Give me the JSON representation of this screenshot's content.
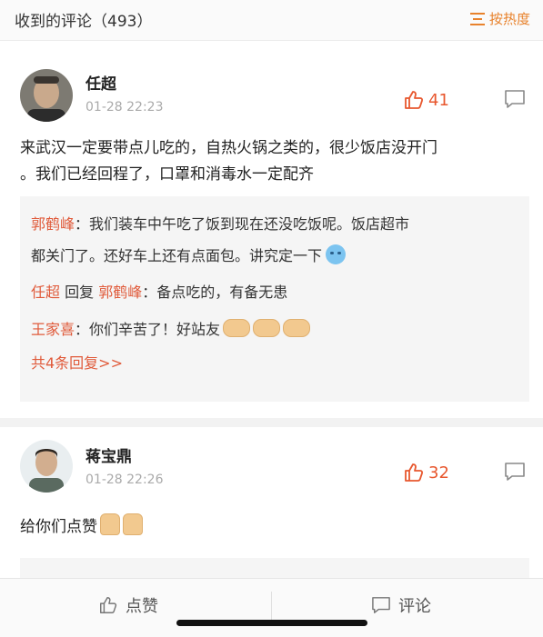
{
  "header": {
    "title": "收到的评论（493）",
    "sort_label": "按热度"
  },
  "comments": [
    {
      "username": "任超",
      "time": "01-28 22:23",
      "likes": "41",
      "text_line1": "来武汉一定要带点儿吃的，自热火锅之类的，很少饭店没开门",
      "text_line2": "。我们已经回程了，口罩和消毒水一定配齐",
      "replies": {
        "r1_name": "郭鹤峰",
        "r1_text_a": "：我们装车中午吃了饭到现在还没吃饭呢。饭店超市",
        "r1_text_b": "都关门了。还好车上还有点面包。讲究定一下",
        "r2_name": "任超",
        "r2_mid": "回复",
        "r2_target": "郭鹤峰",
        "r2_text": "：备点吃的，有备无患",
        "r3_name": "王家喜",
        "r3_text": "：你们辛苦了！好站友",
        "more": "共4条回复>>"
      }
    },
    {
      "username": "蒋宝鼎",
      "time": "01-28 22:26",
      "likes": "32",
      "text": "给你们点赞"
    }
  ],
  "bottom_bar": {
    "like_label": "点赞",
    "comment_label": "评论"
  },
  "colors": {
    "accent": "#e8572e",
    "name_red": "#e05a3a",
    "sort_orange": "#e8822c"
  }
}
